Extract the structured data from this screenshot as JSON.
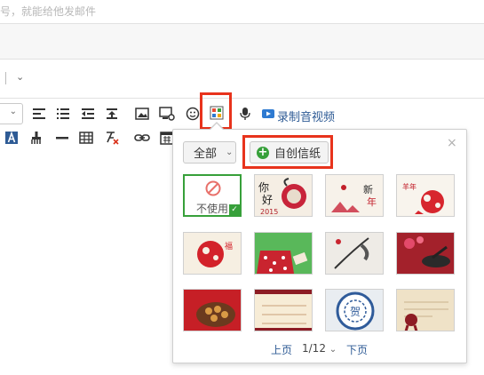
{
  "compose": {
    "hint_text": "号，就能给他发邮件",
    "dropdown_chevron": "⌄"
  },
  "toolbar": {
    "record_label": "录制音视频",
    "icons_row1": [
      "align-left-icon",
      "bullet-list-icon",
      "outdent-icon",
      "indent-icon",
      "image-icon",
      "screenshot-icon",
      "emoji-icon",
      "stationery-icon",
      "microphone-icon",
      "video-icon"
    ],
    "icons_row2": [
      "font-color-icon",
      "format-painter-icon",
      "horizontal-rule-icon",
      "table-icon",
      "clear-format-icon",
      "link-icon",
      "calendar-icon"
    ]
  },
  "stationery_popup": {
    "filter_label": "全部",
    "create_label": "自创信纸",
    "close_symbol": "×",
    "no_use_label": "不使用",
    "pager": {
      "prev": "上页",
      "current": "1/12",
      "next": "下页"
    },
    "thumbnails": [
      {
        "id": "none",
        "selected": true
      },
      {
        "id": "ni-hao-2015-goat"
      },
      {
        "id": "spring-festival-calligraphy"
      },
      {
        "id": "red-paper-cut-goat"
      },
      {
        "id": "red-paper-cut-lion"
      },
      {
        "id": "red-gift-bag"
      },
      {
        "id": "ink-painting"
      },
      {
        "id": "plum-blossom-red"
      },
      {
        "id": "food-basket"
      },
      {
        "id": "lined-paper"
      },
      {
        "id": "blue-white-porcelain-plate"
      },
      {
        "id": "parchment-seal"
      }
    ]
  },
  "colors": {
    "highlight_red": "#e8331c",
    "accent_green": "#37a03a",
    "link_blue": "#2e5b95"
  }
}
